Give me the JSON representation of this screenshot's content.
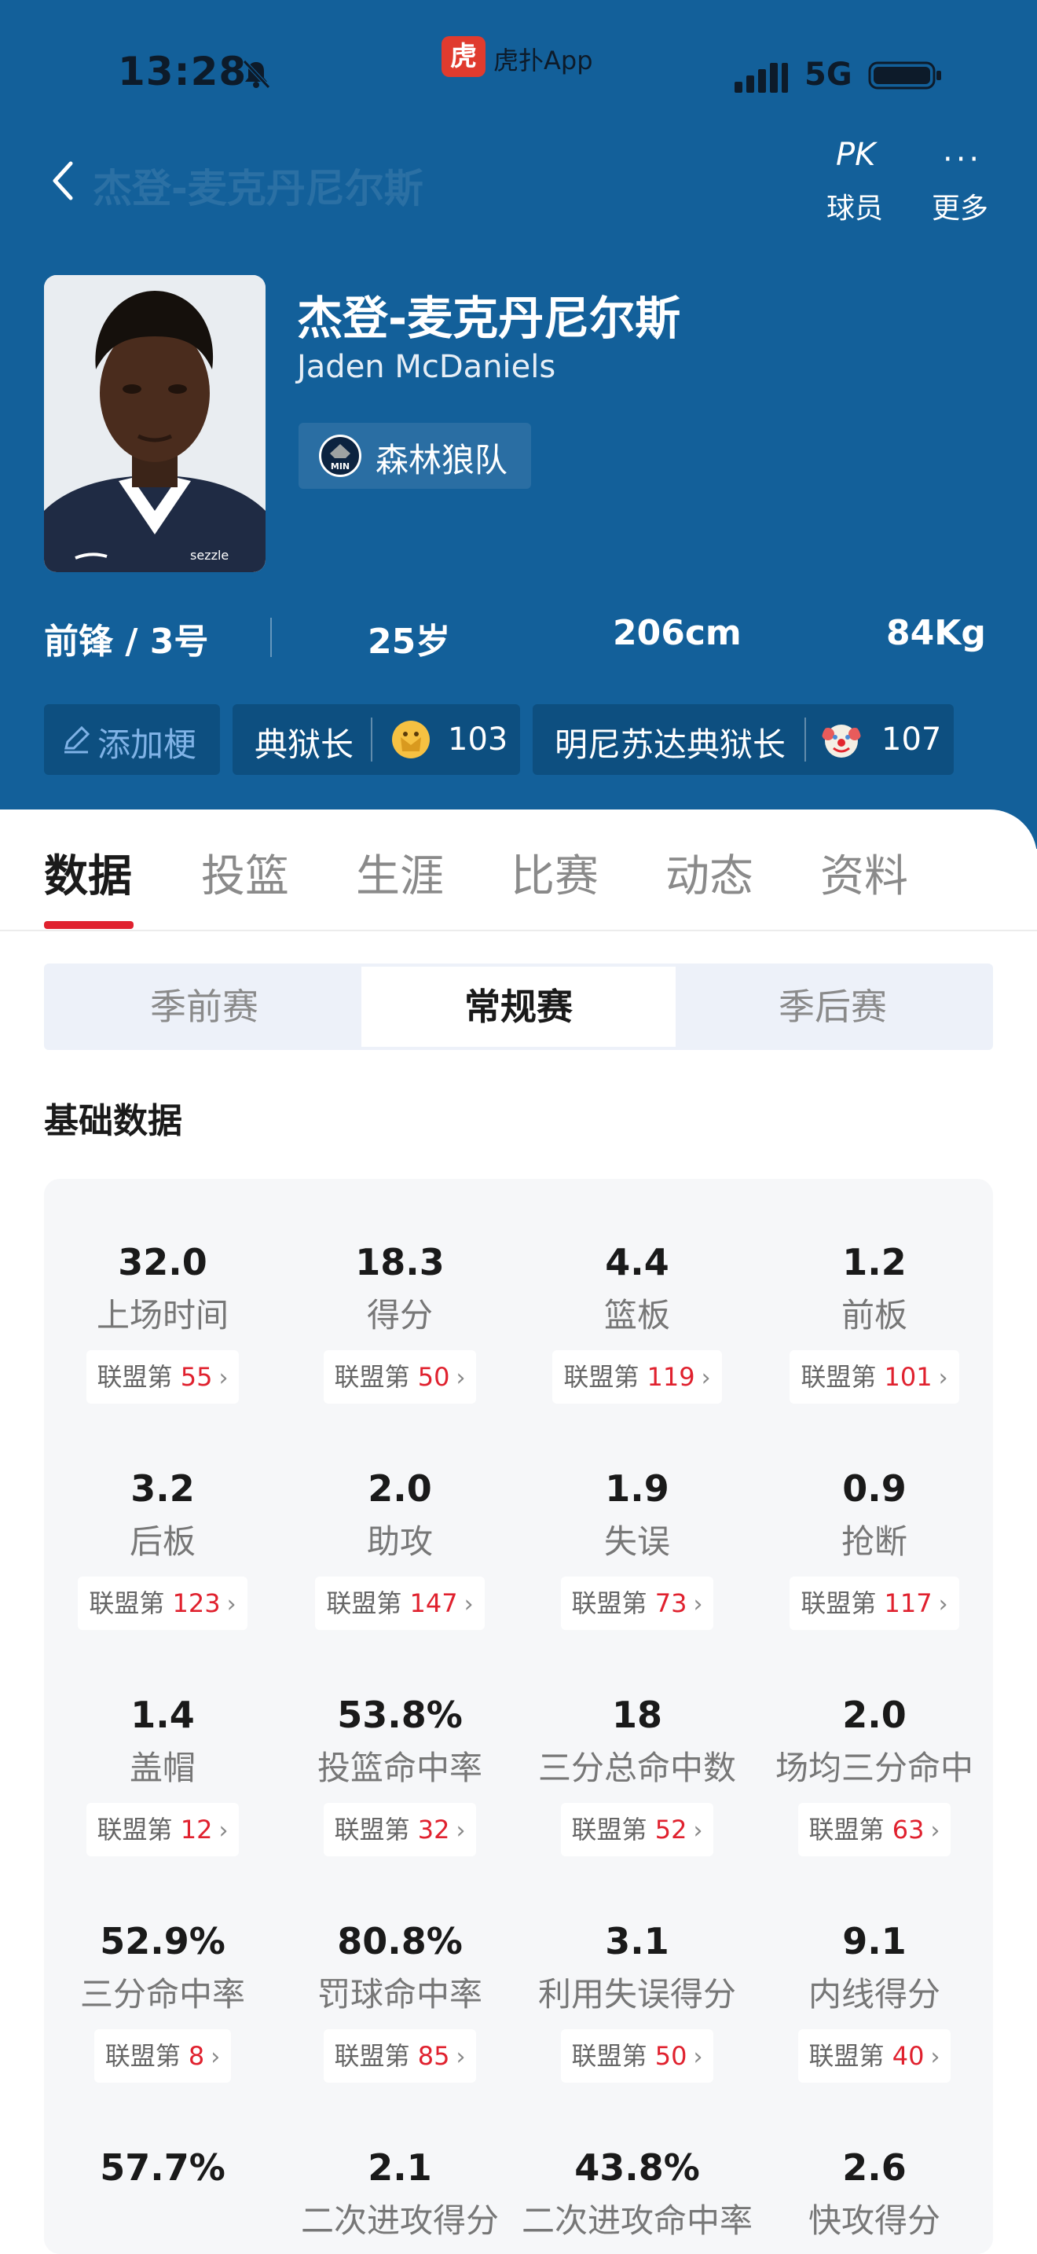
{
  "status_bar": {
    "time": "13:28",
    "app_badge": "虎",
    "app_name": "虎扑App",
    "network": "5G"
  },
  "nav": {
    "back_label": "",
    "faded_title": "杰登-麦克丹尼尔斯",
    "pk_icon": "PK",
    "pk_label": "球员",
    "more_icon": "···",
    "more_label": "更多"
  },
  "player": {
    "name_cn": "杰登-麦克丹尼尔斯",
    "name_en": "Jaden McDaniels",
    "team": "森林狼队",
    "team_logo_text": "MIN",
    "jersey_sponsor": "sezzle",
    "position": "前锋 / 3号",
    "age": "25岁",
    "height": "206cm",
    "weight": "84Kg"
  },
  "tags": {
    "add_label": "添加梗",
    "tag1": {
      "text": "典狱长",
      "count": "103"
    },
    "tag2": {
      "text": "明尼苏达典狱长",
      "count": "107"
    }
  },
  "tabs": [
    "数据",
    "投篮",
    "生涯",
    "比赛",
    "动态",
    "资料"
  ],
  "season_tabs": [
    "季前赛",
    "常规赛",
    "季后赛"
  ],
  "section_title": "基础数据",
  "rank_prefix": "联盟第",
  "stats": [
    {
      "value": "32.0",
      "label": "上场时间",
      "rank": "55"
    },
    {
      "value": "18.3",
      "label": "得分",
      "rank": "50"
    },
    {
      "value": "4.4",
      "label": "篮板",
      "rank": "119"
    },
    {
      "value": "1.2",
      "label": "前板",
      "rank": "101"
    },
    {
      "value": "3.2",
      "label": "后板",
      "rank": "123"
    },
    {
      "value": "2.0",
      "label": "助攻",
      "rank": "147"
    },
    {
      "value": "1.9",
      "label": "失误",
      "rank": "73"
    },
    {
      "value": "0.9",
      "label": "抢断",
      "rank": "117"
    },
    {
      "value": "1.4",
      "label": "盖帽",
      "rank": "12"
    },
    {
      "value": "53.8%",
      "label": "投篮命中率",
      "rank": "32"
    },
    {
      "value": "18",
      "label": "三分总命中数",
      "rank": "52"
    },
    {
      "value": "2.0",
      "label": "场均三分命中",
      "rank": "63"
    },
    {
      "value": "52.9%",
      "label": "三分命中率",
      "rank": "8"
    },
    {
      "value": "80.8%",
      "label": "罚球命中率",
      "rank": "85"
    },
    {
      "value": "3.1",
      "label": "利用失误得分",
      "rank": "50"
    },
    {
      "value": "9.1",
      "label": "内线得分",
      "rank": "40"
    },
    {
      "value": "57.7%",
      "label": "",
      "rank": ""
    },
    {
      "value": "2.1",
      "label": "二次进攻得分",
      "rank": ""
    },
    {
      "value": "43.8%",
      "label": "二次进攻命中率",
      "rank": ""
    },
    {
      "value": "2.6",
      "label": "快攻得分",
      "rank": ""
    }
  ],
  "colors": {
    "header_bg": "#13609a",
    "accent_red": "#e0212e",
    "panel_bg": "#f6f7f9"
  }
}
